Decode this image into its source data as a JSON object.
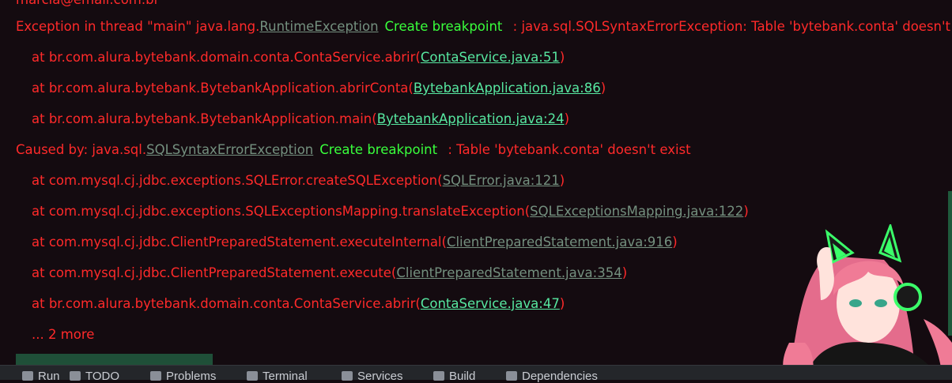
{
  "console": {
    "partial_top": "marcia@email.com.br",
    "exception": {
      "prefix": "Exception in thread \"main\" java.lang.",
      "link": "RuntimeException",
      "bp": "Create breakpoint",
      "suffix": " : java.sql.SQLSyntaxErrorException: Table 'bytebank.conta' doesn't"
    },
    "frames1": [
      {
        "text": "at br.com.alura.bytebank.domain.conta.ContaService.abrir(",
        "link": "ContaService.java:51",
        "close": ")"
      },
      {
        "text": "at br.com.alura.bytebank.BytebankApplication.abrirConta(",
        "link": "BytebankApplication.java:86",
        "close": ")"
      },
      {
        "text": "at br.com.alura.bytebank.BytebankApplication.main(",
        "link": "BytebankApplication.java:24",
        "close": ")"
      }
    ],
    "caused": {
      "prefix": "Caused by: java.sql.",
      "link": "SQLSyntaxErrorException",
      "bp": "Create breakpoint",
      "suffix": " : Table 'bytebank.conta' doesn't exist"
    },
    "frames2": [
      {
        "text": "at com.mysql.cj.jdbc.exceptions.SQLError.createSQLException(",
        "link": "SQLError.java:121",
        "close": ")"
      },
      {
        "text": "at com.mysql.cj.jdbc.exceptions.SQLExceptionsMapping.translateException(",
        "link": "SQLExceptionsMapping.java:122",
        "close": ")"
      },
      {
        "text": "at com.mysql.cj.jdbc.ClientPreparedStatement.executeInternal(",
        "link": "ClientPreparedStatement.java:916",
        "close": ")"
      },
      {
        "text": "at com.mysql.cj.jdbc.ClientPreparedStatement.execute(",
        "link": "ClientPreparedStatement.java:354",
        "close": ")"
      },
      {
        "text": "at br.com.alura.bytebank.domain.conta.ContaService.abrir(",
        "link": "ContaService.java:47",
        "close": ")"
      }
    ],
    "more": "... 2 more"
  },
  "toolwindow": {
    "items": [
      "Run",
      "TODO",
      "Problems",
      "Terminal",
      "Services",
      "Build",
      "Dependencies"
    ]
  },
  "colors": {
    "background": "#140b10",
    "error_text": "#ff2a2a",
    "link_project": "#57e8a1",
    "link_library": "#74907f",
    "breakpoint": "#39ff3c"
  },
  "icons": [
    "run-icon",
    "todo-icon",
    "problems-icon",
    "terminal-icon",
    "services-icon",
    "build-icon",
    "dependencies-icon"
  ]
}
